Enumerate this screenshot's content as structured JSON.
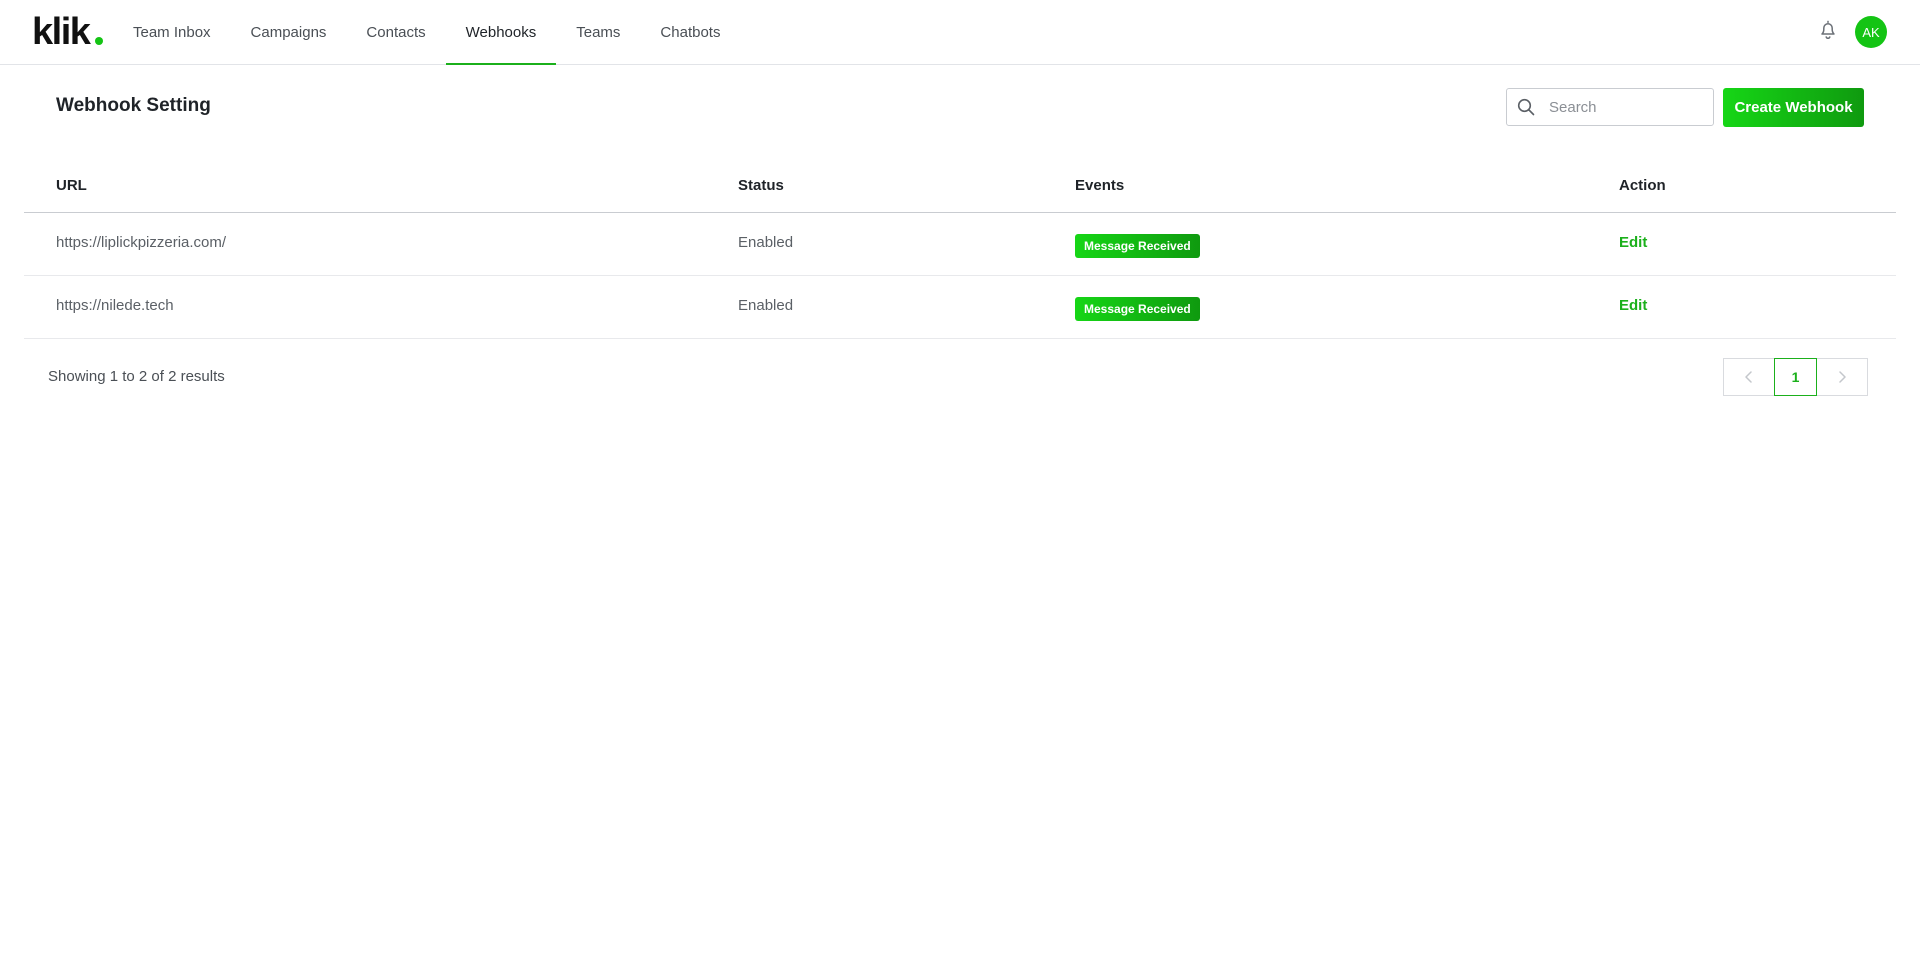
{
  "colors": {
    "accent": "#1bb01b",
    "button_gradient_start": "#16d616",
    "button_gradient_end": "#0f9a0f",
    "avatar": "#14c414"
  },
  "app": {
    "logo_text": "klik"
  },
  "nav": {
    "items": [
      {
        "label": "Team Inbox",
        "active": false
      },
      {
        "label": "Campaigns",
        "active": false
      },
      {
        "label": "Contacts",
        "active": false
      },
      {
        "label": "Webhooks",
        "active": true
      },
      {
        "label": "Teams",
        "active": false
      },
      {
        "label": "Chatbots",
        "active": false
      }
    ],
    "notification_icon": "bell-icon",
    "avatar_initials": "AK"
  },
  "page": {
    "title": "Webhook Setting",
    "search": {
      "placeholder": "Search",
      "value": ""
    },
    "create_button_label": "Create Webhook"
  },
  "table": {
    "headers": {
      "url": "URL",
      "status": "Status",
      "events": "Events",
      "action": "Action"
    },
    "rows": [
      {
        "url": "https://liplickpizzeria.com/",
        "status": "Enabled",
        "event": "Message Received",
        "action": "Edit"
      },
      {
        "url": "https://nilede.tech",
        "status": "Enabled",
        "event": "Message Received",
        "action": "Edit"
      }
    ]
  },
  "footer": {
    "results_text": "Showing 1 to 2 of 2 results",
    "current_page": "1"
  }
}
